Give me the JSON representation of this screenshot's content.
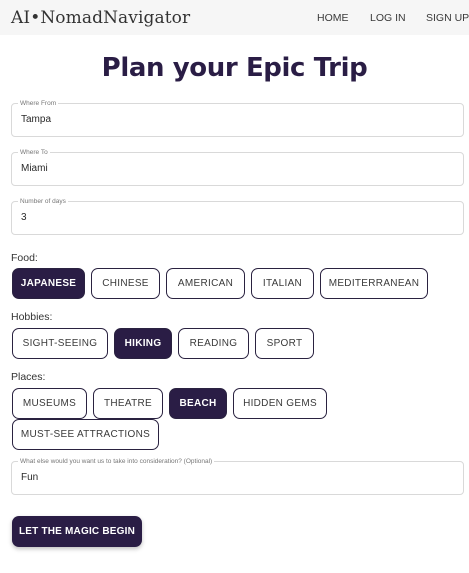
{
  "nav": {
    "brand": "AI•NomadNavigator",
    "links": [
      "HOME",
      "LOG IN",
      "SIGN UP"
    ]
  },
  "page": {
    "title": "Plan your Epic Trip"
  },
  "form": {
    "where_from": {
      "label": "Where From",
      "value": "Tampa"
    },
    "where_to": {
      "label": "Where To",
      "value": "Miami"
    },
    "days": {
      "label": "Number of days",
      "value": "3"
    },
    "notes": {
      "label": "What else would you want us to take into consideration? (Optional)",
      "value": "Fun"
    }
  },
  "groups": {
    "food": {
      "label": "Food:",
      "options": [
        {
          "text": "JAPANESE",
          "selected": true
        },
        {
          "text": "CHINESE",
          "selected": false
        },
        {
          "text": "AMERICAN",
          "selected": false
        },
        {
          "text": "ITALIAN",
          "selected": false
        },
        {
          "text": "MEDITERRANEAN",
          "selected": false
        }
      ]
    },
    "hobbies": {
      "label": "Hobbies:",
      "options": [
        {
          "text": "SIGHT-SEEING",
          "selected": false
        },
        {
          "text": "HIKING",
          "selected": true
        },
        {
          "text": "READING",
          "selected": false
        },
        {
          "text": "SPORT",
          "selected": false
        }
      ]
    },
    "places": {
      "label": "Places:",
      "options": [
        {
          "text": "MUSEUMS",
          "selected": false
        },
        {
          "text": "THEATRE",
          "selected": false
        },
        {
          "text": "BEACH",
          "selected": true
        },
        {
          "text": "HIDDEN GEMS",
          "selected": false
        },
        {
          "text": "MUST-SEE ATTRACTIONS",
          "selected": false
        }
      ]
    }
  },
  "submit_label": "LET THE MAGIC BEGIN",
  "colors": {
    "accent": "#2a1d45",
    "navbar_bg": "#f6f6f6",
    "field_border": "#d9d9d9"
  }
}
